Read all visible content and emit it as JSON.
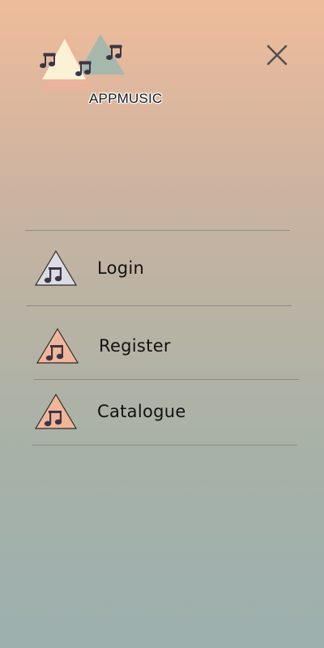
{
  "app": {
    "logo_text": "APPMUSIC",
    "logo_colors": {
      "left_triangle": "#fbf2d6",
      "right_triangle": "#a6b7ab",
      "shadow_triangle": "#f2b09a",
      "note": "#3a3547"
    }
  },
  "header": {
    "close_icon": "close-icon",
    "close_color": "#4f4f52"
  },
  "menu": {
    "items": [
      {
        "label": "Login",
        "icon": "music-triangle-icon",
        "icon_fill": "#dcdde2"
      },
      {
        "label": "Register",
        "icon": "music-triangle-icon",
        "icon_fill": "#f1b69a"
      },
      {
        "label": "Catalogue",
        "icon": "music-triangle-icon",
        "icon_fill": "#f1b69a"
      }
    ]
  }
}
